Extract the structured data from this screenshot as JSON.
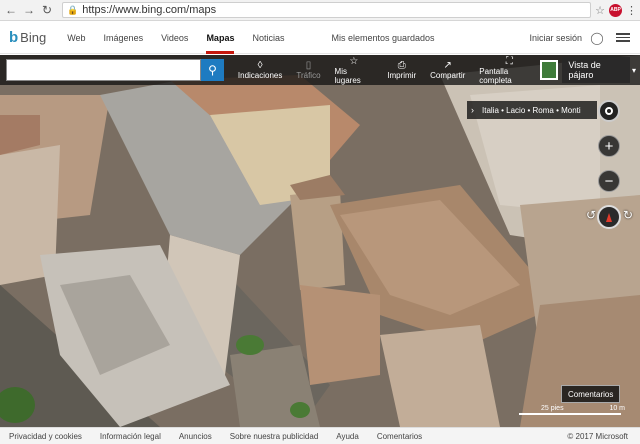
{
  "browser": {
    "url": "https://www.bing.com/maps",
    "abp_badge": "ABP"
  },
  "header": {
    "logo_text": "Bing",
    "nav": [
      {
        "label": "Web"
      },
      {
        "label": "Imágenes"
      },
      {
        "label": "Videos"
      },
      {
        "label": "Mapas",
        "active": true
      },
      {
        "label": "Noticias"
      }
    ],
    "saved": "Mis elementos guardados",
    "signin": "Iniciar sesión"
  },
  "toolbar": {
    "search_placeholder": "",
    "tools": [
      {
        "icon": "directions-icon",
        "label": "Indicaciones"
      },
      {
        "icon": "traffic-icon",
        "label": "Tráfico",
        "disabled": true
      },
      {
        "icon": "star-icon",
        "label": "Mis lugares"
      },
      {
        "icon": "print-icon",
        "label": "Imprimir"
      },
      {
        "icon": "share-icon",
        "label": "Compartir"
      },
      {
        "icon": "fullscreen-icon",
        "label": "Pantalla completa"
      }
    ],
    "view": "Vista de pájaro"
  },
  "breadcrumb": "Italia • Lacio • Roma • Monti",
  "feedback": "Comentarios",
  "scale": {
    "left": "25 pies",
    "right": "10 m"
  },
  "footer": {
    "links": [
      "Privacidad y cookies",
      "Información legal",
      "Anuncios",
      "Sobre nuestra publicidad",
      "Ayuda",
      "Comentarios"
    ],
    "copyright": "© 2017 Microsoft"
  },
  "colors": {
    "accent": "#c5170d",
    "search_button": "#1e7bc1"
  }
}
